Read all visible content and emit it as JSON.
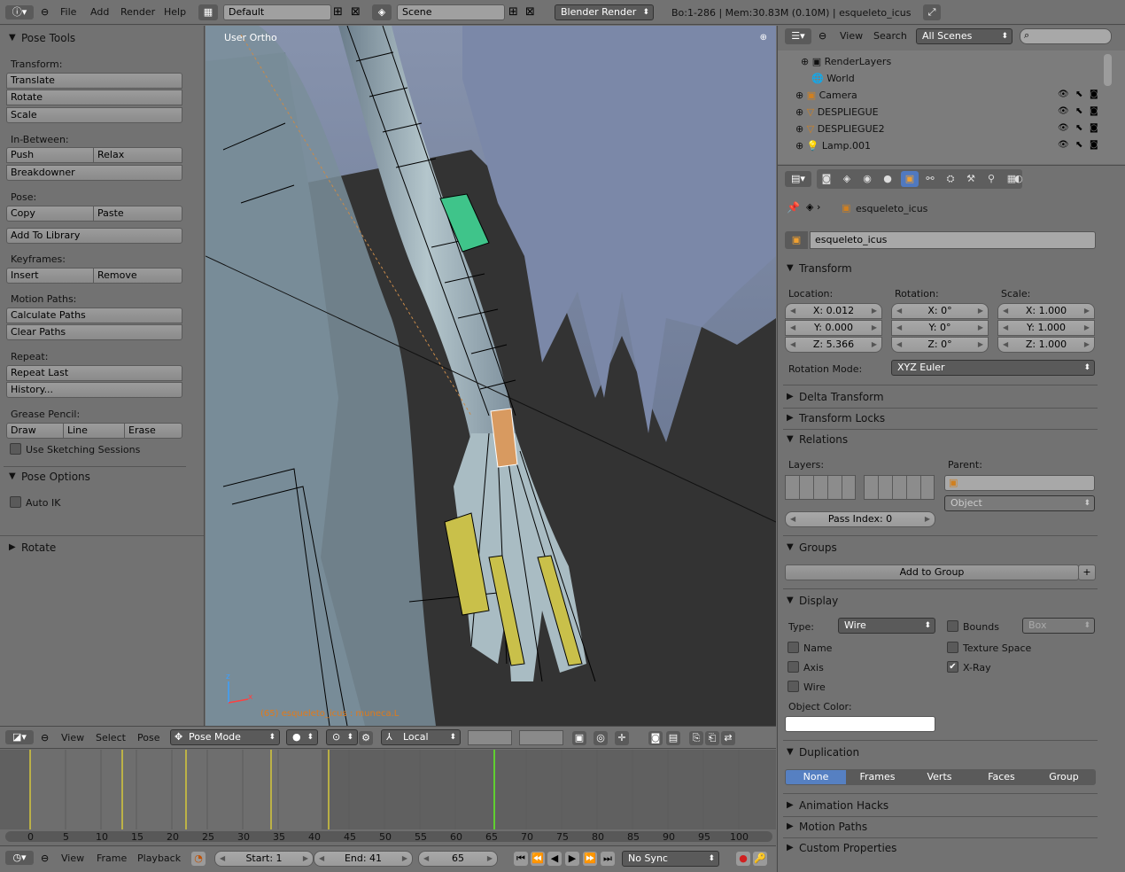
{
  "topbar": {
    "menus": [
      "File",
      "Add",
      "Render",
      "Help"
    ],
    "layout": "Default",
    "scene": "Scene",
    "engine": "Blender Render",
    "stats": "Bo:1-286  | Mem:30.83M (0.10M) | esqueleto_icus"
  },
  "toolshelf": {
    "title": "Pose Tools",
    "transform_label": "Transform:",
    "translate": "Translate",
    "rotate": "Rotate",
    "scale": "Scale",
    "inbetween_label": "In-Between:",
    "push": "Push",
    "relax": "Relax",
    "breakdowner": "Breakdowner",
    "pose_label": "Pose:",
    "copy": "Copy",
    "paste": "Paste",
    "add_library": "Add To Library",
    "keyframes_label": "Keyframes:",
    "insert": "Insert",
    "remove": "Remove",
    "motion_label": "Motion Paths:",
    "calc_paths": "Calculate Paths",
    "clear_paths": "Clear Paths",
    "repeat_label": "Repeat:",
    "repeat_last": "Repeat Last",
    "history": "History...",
    "grease_label": "Grease Pencil:",
    "draw": "Draw",
    "line": "Line",
    "erase": "Erase",
    "sketching": "Use Sketching Sessions",
    "pose_options": "Pose Options",
    "auto_ik": "Auto IK",
    "rotate_panel": "Rotate"
  },
  "viewport": {
    "view_name": "User Ortho",
    "object_label": "(65) esqueleto_icus : muneca.L",
    "axis_x": "x",
    "axis_z": "z",
    "menus": [
      "View",
      "Select",
      "Pose"
    ],
    "mode": "Pose Mode",
    "orientation": "Local"
  },
  "outliner": {
    "menus": [
      "View",
      "Search"
    ],
    "scenes": "All Scenes",
    "items": [
      "RenderLayers",
      "World",
      "Camera",
      "DESPLIEGUE",
      "DESPLIEGUE2",
      "Lamp.001"
    ]
  },
  "properties": {
    "breadcrumb": "esqueleto_icus",
    "object_name": "esqueleto_icus",
    "transform": "Transform",
    "location_label": "Location:",
    "rotation_label": "Rotation:",
    "scale_label": "Scale:",
    "loc_x": "X: 0.012",
    "loc_y": "Y: 0.000",
    "loc_z": "Z: 5.366",
    "rot_x": "X: 0°",
    "rot_y": "Y: 0°",
    "rot_z": "Z: 0°",
    "scale_x": "X: 1.000",
    "scale_y": "Y: 1.000",
    "scale_z": "Z: 1.000",
    "rotation_mode_label": "Rotation Mode:",
    "rotation_mode": "XYZ Euler",
    "delta_transform": "Delta Transform",
    "transform_locks": "Transform Locks",
    "relations": "Relations",
    "layers_label": "Layers:",
    "parent_label": "Parent:",
    "parent_type": "Object",
    "pass_index": "Pass Index: 0",
    "groups": "Groups",
    "add_group": "Add to Group",
    "display": "Display",
    "type_label": "Type:",
    "type_value": "Wire",
    "bounds": "Bounds",
    "bounds_type": "Box",
    "name": "Name",
    "texture_space": "Texture Space",
    "axis": "Axis",
    "xray": "X-Ray",
    "wire": "Wire",
    "object_color": "Object Color:",
    "duplication": "Duplication",
    "dup_none": "None",
    "dup_frames": "Frames",
    "dup_verts": "Verts",
    "dup_faces": "Faces",
    "dup_group": "Group",
    "animation_hacks": "Animation Hacks",
    "motion_paths": "Motion Paths",
    "custom_properties": "Custom Properties"
  },
  "timeline": {
    "ticks": [
      "0",
      "5",
      "10",
      "15",
      "20",
      "25",
      "30",
      "35",
      "40",
      "45",
      "50",
      "55",
      "60",
      "65",
      "70",
      "75",
      "80",
      "85",
      "90",
      "95",
      "100"
    ],
    "menus": [
      "View",
      "Frame",
      "Playback"
    ],
    "start": "Start: 1",
    "end": "End: 41",
    "current": "65",
    "sync": "No Sync"
  }
}
